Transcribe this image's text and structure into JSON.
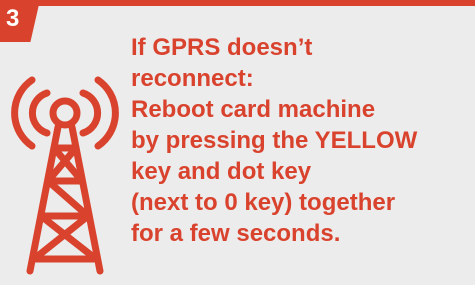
{
  "step": {
    "number": "3"
  },
  "colors": {
    "accent": "#d9432e",
    "background": "#ececec"
  },
  "icon": {
    "name": "cell-tower-signal-icon"
  },
  "content": {
    "heading_lines": [
      "If GPRS doesn’t",
      "reconnect:"
    ],
    "instruction_lines": [
      "Reboot card machine",
      "by pressing the YELLOW",
      "key and dot key",
      "(next to 0 key) together",
      "for a few seconds."
    ]
  }
}
